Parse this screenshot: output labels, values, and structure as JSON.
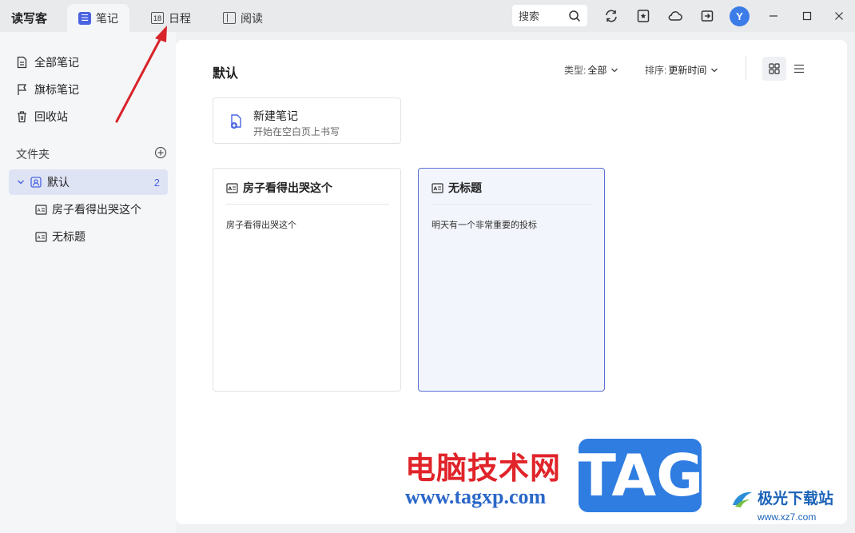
{
  "app": {
    "name": "读写客"
  },
  "tabs": [
    {
      "label": "笔记",
      "icon": "note-icon",
      "glyph": "☰"
    },
    {
      "label": "日程",
      "icon": "calendar-icon",
      "glyph": "18"
    },
    {
      "label": "阅读",
      "icon": "book-icon"
    }
  ],
  "search": {
    "label": "搜索"
  },
  "user": {
    "avatar_letter": "Y"
  },
  "sidebar": {
    "items": [
      {
        "label": "全部笔记"
      },
      {
        "label": "旗标笔记"
      },
      {
        "label": "回收站"
      }
    ],
    "section_title": "文件夹",
    "folder": {
      "label": "默认",
      "count": "2"
    },
    "notes": [
      {
        "label": "房子看得出哭这个"
      },
      {
        "label": "无标题"
      }
    ]
  },
  "main": {
    "title": "默认",
    "filter_type": {
      "label": "类型:",
      "value": "全部"
    },
    "sort": {
      "label": "排序:",
      "value": "更新时间"
    },
    "new_note": {
      "title": "新建笔记",
      "subtitle": "开始在空白页上书写"
    },
    "cards": [
      {
        "title": "房子看得出哭这个",
        "body": "房子看得出哭这个"
      },
      {
        "title": "无标题",
        "body": "明天有一个非常重要的投标"
      }
    ]
  },
  "watermarks": {
    "site_cn": "电脑技术网",
    "site_url": "www.tagxp.com",
    "tag_logo": "TAG",
    "jg_name": "极光下载站",
    "jg_url": "www.xz7.com"
  },
  "colors": {
    "accent": "#4a63e0",
    "avatar": "#3b7ce8",
    "arrow": "#d9232a",
    "selected_card_bg": "#f3f5fc"
  }
}
